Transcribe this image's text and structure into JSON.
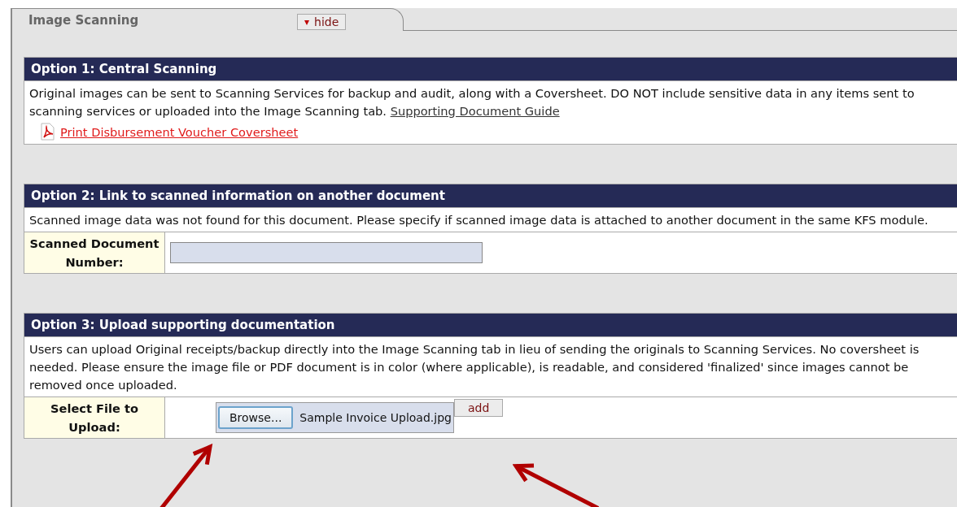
{
  "tab": {
    "title": "Image Scanning",
    "toggle": {
      "icon": "▾",
      "label": "hide"
    }
  },
  "sections": [
    {
      "kind": "links",
      "header": "Option 1: Central Scanning",
      "text": "Original images can be sent to Scanning Services for backup and audit, along with a Coversheet. DO NOT include sensitive data in any items sent to scanning services or uploaded into the Image Scanning tab.",
      "link": "Supporting Document Guide",
      "pdf_link": "Print Disbursement Voucher Coversheet"
    },
    {
      "kind": "field",
      "header": "Option 2: Link to scanned information on another document",
      "text": "Scanned image data was not found for this document. Please specify if scanned image data is attached to another document in the same KFS module.",
      "label": "Scanned Document Number:"
    },
    {
      "kind": "upload",
      "header": "Option 3: Upload supporting documentation",
      "text": "Users can upload Original receipts/backup directly into the Image Scanning tab in lieu of sending the originals to Scanning Services. No coversheet is needed. Please ensure the image file or PDF document is in color (where applicable), is readable, and considered 'finalized' since images cannot be removed once uploaded.",
      "label": "Select File to Upload:",
      "browse_button": "Browse...",
      "file_name": "Sample Invoice Upload.jpg",
      "add_button": "add"
    }
  ]
}
